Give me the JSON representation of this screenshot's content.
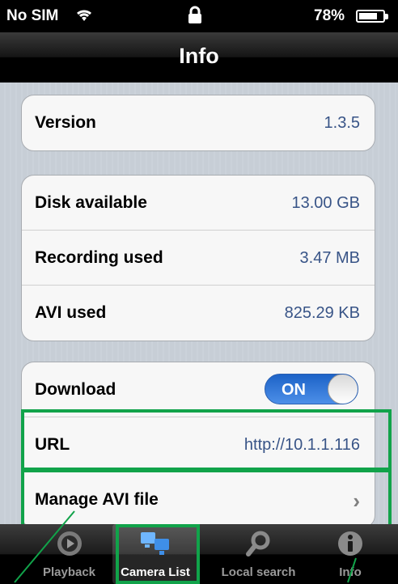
{
  "status_bar": {
    "carrier": "No SIM",
    "battery": "78%"
  },
  "nav": {
    "title": "Info"
  },
  "groups": {
    "version": {
      "label": "Version",
      "value": "1.3.5"
    },
    "disk": {
      "disk_available": {
        "label": "Disk available",
        "value": "13.00 GB"
      },
      "recording_used": {
        "label": "Recording used",
        "value": "3.47 MB"
      },
      "avi_used": {
        "label": "AVI used",
        "value": "825.29 KB"
      }
    },
    "download": {
      "download": {
        "label": "Download",
        "toggle": "ON"
      },
      "url": {
        "label": "URL",
        "value": "http://10.1.1.116"
      },
      "manage": {
        "label": "Manage AVI file"
      }
    }
  },
  "tabbar": {
    "tabs": [
      {
        "label": "Playback",
        "icon": "playback-icon"
      },
      {
        "label": "Camera List",
        "icon": "camera-list-icon",
        "selected": true
      },
      {
        "label": "Local search",
        "icon": "search-icon"
      },
      {
        "label": "Info",
        "icon": "info-icon"
      }
    ]
  },
  "colors": {
    "accent": "#2f6bd0",
    "value_text": "#385487",
    "highlight": "#11a34a"
  }
}
